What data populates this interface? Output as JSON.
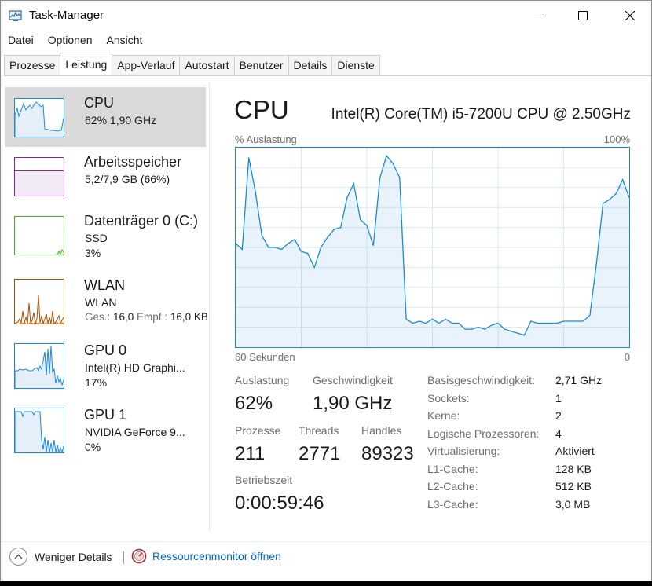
{
  "window": {
    "title": "Task-Manager"
  },
  "menu": [
    "Datei",
    "Optionen",
    "Ansicht"
  ],
  "tabs": [
    {
      "label": "Prozesse"
    },
    {
      "label": "Leistung",
      "active": true
    },
    {
      "label": "App-Verlauf"
    },
    {
      "label": "Autostart"
    },
    {
      "label": "Benutzer"
    },
    {
      "label": "Details"
    },
    {
      "label": "Dienste"
    }
  ],
  "sidebar": {
    "items": [
      {
        "title": "CPU",
        "sub1": "62% 1,90 GHz",
        "color": "#1b8ad6",
        "selected": true
      },
      {
        "title": "Arbeitsspeicher",
        "sub1": "5,2/7,9 GB (66%)",
        "color": "#8b1fb0",
        "memory_fill": 0.66
      },
      {
        "title": "Datenträger 0 (C:)",
        "sub1": "SSD",
        "sub2": "3%",
        "color": "#4cae2a"
      },
      {
        "title": "WLAN",
        "sub1": "WLAN",
        "sub2_a": "Ges.: ",
        "sub2_b": "16,0",
        "sub2_c": " Empf.: ",
        "sub2_d": "16,0 KB",
        "color": "#a74f01"
      },
      {
        "title": "GPU 0",
        "sub1": "Intel(R) HD Graphi...",
        "sub2": "17%",
        "color": "#1b8ad6"
      },
      {
        "title": "GPU 1",
        "sub1": "NVIDIA GeForce 9...",
        "sub2": "0%",
        "color": "#1b8ad6"
      }
    ]
  },
  "main": {
    "title": "CPU",
    "processor": "Intel(R) Core(TM) i5-7200U CPU @ 2.50GHz",
    "graph_label_left": "% Auslastung",
    "graph_label_right": "100%",
    "graph_foot_left": "60 Sekunden",
    "graph_foot_right": "0",
    "stats": {
      "auslastung_label": "Auslastung",
      "auslastung": "62%",
      "geschwindigkeit_label": "Geschwindigkeit",
      "geschwindigkeit": "1,90 GHz",
      "prozesse_label": "Prozesse",
      "prozesse": "211",
      "threads_label": "Threads",
      "threads": "2771",
      "handles_label": "Handles",
      "handles": "89323",
      "betriebszeit_label": "Betriebszeit",
      "betriebszeit": "0:00:59:46"
    },
    "info": [
      {
        "k": "Basisgeschwindigkeit:",
        "v": "2,71 GHz"
      },
      {
        "k": "Sockets:",
        "v": "1"
      },
      {
        "k": "Kerne:",
        "v": "2"
      },
      {
        "k": "Logische Prozessoren:",
        "v": "4"
      },
      {
        "k": "Virtualisierung:",
        "v": "Aktiviert"
      },
      {
        "k": "L1-Cache:",
        "v": "128 KB"
      },
      {
        "k": "L2-Cache:",
        "v": "512 KB"
      },
      {
        "k": "L3-Cache:",
        "v": "3,0 MB"
      }
    ]
  },
  "chart_data": {
    "type": "area",
    "ylim": [
      0,
      100
    ],
    "x": [
      60,
      59,
      58,
      57,
      56,
      55,
      54,
      53,
      52,
      51,
      50,
      49,
      48,
      47,
      46,
      45,
      44,
      43,
      42,
      41,
      40,
      39,
      38,
      37,
      36,
      35,
      34,
      33,
      32,
      31,
      30,
      29,
      28,
      27,
      26,
      25,
      24,
      23,
      22,
      21,
      20,
      19,
      18,
      17,
      16,
      15,
      14,
      13,
      12,
      11,
      10,
      9,
      8,
      7,
      6,
      5,
      4,
      3,
      2,
      1,
      0
    ],
    "values": [
      52,
      49,
      95,
      78,
      56,
      50,
      50,
      49,
      52,
      54,
      48,
      47,
      40,
      50,
      55,
      59,
      60,
      75,
      82,
      64,
      61,
      51,
      85,
      96,
      92,
      85,
      14,
      12,
      13,
      12,
      14,
      12,
      14,
      12,
      12,
      9,
      9,
      10,
      9,
      11,
      12,
      9,
      8,
      7,
      6,
      13,
      12,
      12,
      12,
      12,
      13,
      13,
      13,
      13,
      16,
      42,
      72,
      74,
      77,
      84,
      75
    ],
    "color": "#1b8ad6"
  },
  "footer": {
    "less_label": "Weniger Details",
    "resmon_label": "Ressourcenmonitor öffnen"
  }
}
